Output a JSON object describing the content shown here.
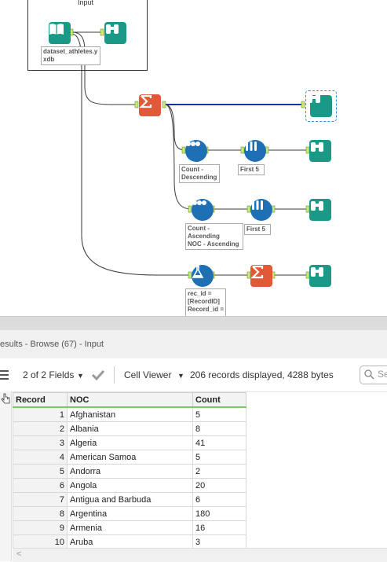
{
  "workflow": {
    "container_title": "Input",
    "input_annotation": [
      "dataset_athletes.y",
      "xdb"
    ],
    "sort_desc_annotation": [
      "Count -",
      "Descending"
    ],
    "sample1_annotation": [
      "First 5"
    ],
    "sort_asc_annotation": [
      "Count -",
      "Ascending",
      "NOC - Ascending"
    ],
    "sample2_annotation": [
      "First 5"
    ],
    "formula_annotation": [
      "rec_id =",
      "[RecordID]",
      "Record_id ="
    ],
    "colors": {
      "summarize": "#e05a38",
      "browse": "#1a9a86",
      "sort": "#1f6fb5",
      "sample": "#1f6fb5",
      "formula": "#1f6fb5",
      "connection": "#3a3a3a",
      "selected_connection": "#1a2fa8"
    },
    "icons": [
      "input-book-icon",
      "browse-binoculars-icon",
      "summarize-sigma-icon",
      "sort-icon",
      "sample-icon",
      "formula-flask-icon"
    ]
  },
  "results": {
    "title": "esults - Browse (67) - Input",
    "fields_label": "2 of 2 Fields",
    "cell_viewer_label": "Cell Viewer",
    "records_info": "206 records displayed, 4288 bytes",
    "search_placeholder": "Se",
    "columns": [
      "Record",
      "NOC",
      "Count"
    ],
    "rows": [
      [
        "1",
        "Afghanistan",
        "5"
      ],
      [
        "2",
        "Albania",
        "8"
      ],
      [
        "3",
        "Algeria",
        "41"
      ],
      [
        "4",
        "American Samoa",
        "5"
      ],
      [
        "5",
        "Andorra",
        "2"
      ],
      [
        "6",
        "Angola",
        "20"
      ],
      [
        "7",
        "Antigua and Barbuda",
        "6"
      ],
      [
        "8",
        "Argentina",
        "180"
      ],
      [
        "9",
        "Armenia",
        "16"
      ],
      [
        "10",
        "Aruba",
        "3"
      ]
    ],
    "scroll_left": "<"
  }
}
